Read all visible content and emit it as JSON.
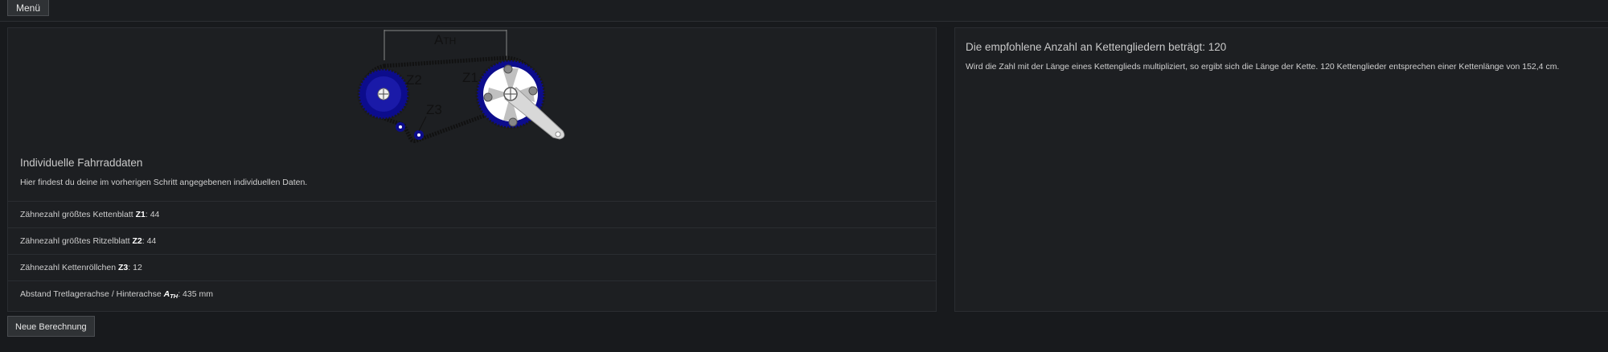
{
  "topbar": {
    "menu_label": "Menü"
  },
  "diagram": {
    "labels": {
      "ath_main": "A",
      "ath_sub": "TH",
      "z1": "Z1",
      "z2": "Z2",
      "z3": "Z3"
    },
    "colors": {
      "sprocket": "#0c0c8c",
      "chain": "#111111",
      "crank": "#cfcfcf",
      "outline": "#ffffff"
    }
  },
  "individual": {
    "title": "Individuelle Fahrraddaten",
    "description": "Hier findest du deine im vorherigen Schritt angegebenen individuellen Daten.",
    "rows": [
      {
        "prefix": "Zähnezahl größtes Kettenblatt ",
        "key": "Z1",
        "sep": ": ",
        "value": "44"
      },
      {
        "prefix": "Zähnezahl größtes Ritzelblatt ",
        "key": "Z2",
        "sep": ": ",
        "value": "44"
      },
      {
        "prefix": "Zähnezahl Kettenröllchen ",
        "key": "Z3",
        "sep": ": ",
        "value": "12"
      },
      {
        "prefix": "Abstand Tretlagerachse / Hinterachse ",
        "key_main": "A",
        "key_sub": "TH",
        "sep": ": ",
        "value": "435 mm"
      }
    ]
  },
  "result": {
    "title": "Die empfohlene Anzahl an Kettengliedern beträgt: 120",
    "text": "Wird die Zahl mit der Länge eines Kettenglieds multipliziert, so ergibt sich die Länge der Kette. 120 Kettenglieder entsprechen einer Kettenlänge von 152,4 cm."
  },
  "actions": {
    "new_calculation_label": "Neue Berechnung"
  }
}
